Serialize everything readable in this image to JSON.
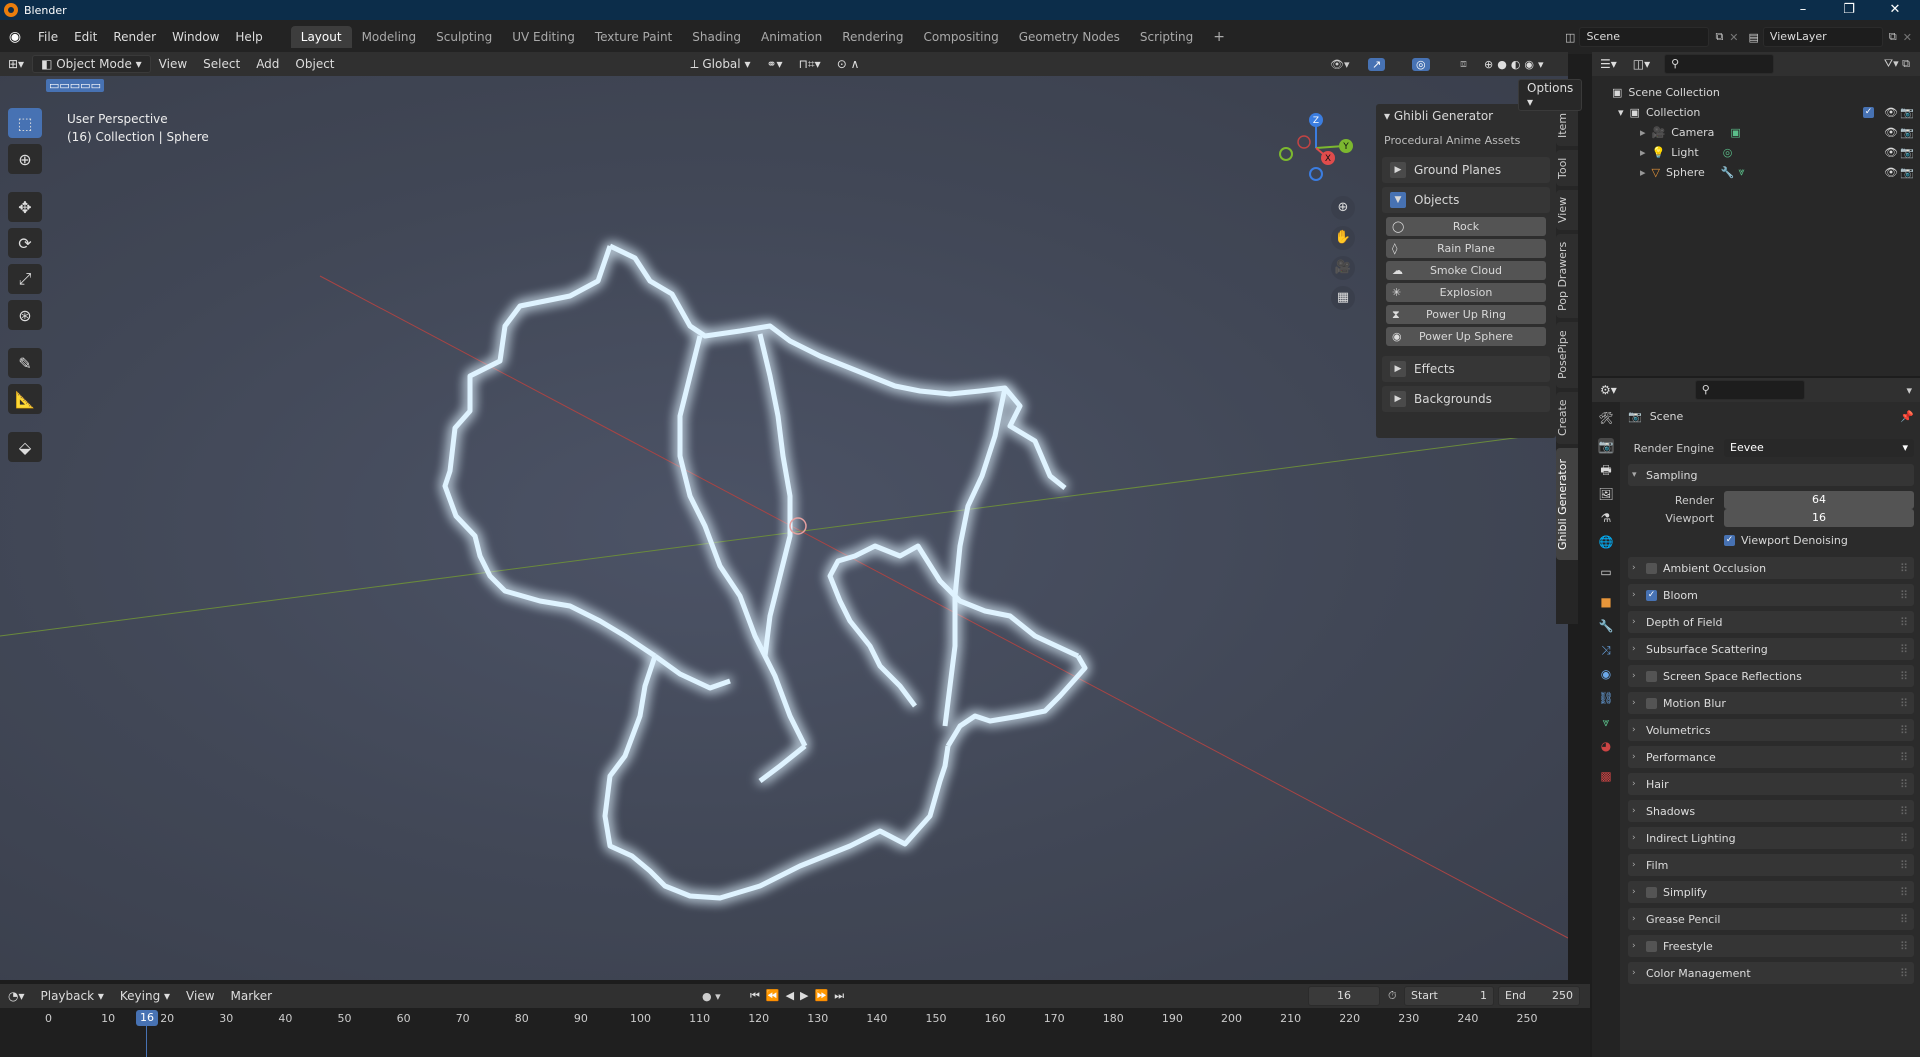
{
  "window": {
    "title": "Blender",
    "controls": [
      "–",
      "❐",
      "✕"
    ]
  },
  "menu": {
    "items": [
      "File",
      "Edit",
      "Render",
      "Window",
      "Help"
    ],
    "workspaces": [
      "Layout",
      "Modeling",
      "Sculpting",
      "UV Editing",
      "Texture Paint",
      "Shading",
      "Animation",
      "Rendering",
      "Compositing",
      "Geometry Nodes",
      "Scripting"
    ],
    "active_workspace": "Layout",
    "add": "+",
    "scene": "Scene",
    "view_layer": "ViewLayer"
  },
  "viewport_header": {
    "mode": "Object Mode",
    "menus": [
      "View",
      "Select",
      "Add",
      "Object"
    ],
    "orientation": "Global",
    "options": "Options"
  },
  "viewport": {
    "perspective": "User Perspective",
    "selection": "(16) Collection | Sphere"
  },
  "gizmo": {
    "z": "Z",
    "y": "Y",
    "x": "X"
  },
  "npanel": {
    "title": "Ghibli Generator",
    "subtitle": "Procedural Anime Assets",
    "ground": "Ground Planes",
    "objects": "Objects",
    "buttons": [
      {
        "label": "Rock",
        "icon": "◯"
      },
      {
        "label": "Rain Plane",
        "icon": "◊"
      },
      {
        "label": "Smoke Cloud",
        "icon": "☁"
      },
      {
        "label": "Explosion",
        "icon": "✳"
      },
      {
        "label": "Power Up Ring",
        "icon": "⧗"
      },
      {
        "label": "Power Up Sphere",
        "icon": "◉"
      }
    ],
    "effects": "Effects",
    "backgrounds": "Backgrounds",
    "tabs": [
      "Item",
      "Tool",
      "View",
      "Pop Drawers",
      "PosePipe",
      "Create",
      "Ghibli Generator"
    ]
  },
  "timeline": {
    "menus": [
      "Playback",
      "Keying",
      "View",
      "Marker"
    ],
    "current_frame": "16",
    "start_label": "Start",
    "start": "1",
    "end_label": "End",
    "end": "250",
    "ticks": [
      "0",
      "10",
      "20",
      "30",
      "40",
      "50",
      "60",
      "70",
      "80",
      "90",
      "100",
      "110",
      "120",
      "130",
      "140",
      "150",
      "160",
      "170",
      "180",
      "190",
      "200",
      "210",
      "220",
      "230",
      "240",
      "250"
    ]
  },
  "outliner": {
    "scene_collection": "Scene Collection",
    "collection": "Collection",
    "items": [
      "Camera",
      "Light",
      "Sphere"
    ]
  },
  "properties": {
    "scene": "Scene",
    "render_engine_label": "Render Engine",
    "render_engine": "Eevee",
    "sampling": "Sampling",
    "render_label": "Render",
    "render_value": "64",
    "viewport_label": "Viewport",
    "viewport_value": "16",
    "denoise": "Viewport Denoising",
    "sections": [
      {
        "label": "Ambient Occlusion",
        "checkbox": true,
        "checked": false
      },
      {
        "label": "Bloom",
        "checkbox": true,
        "checked": true
      },
      {
        "label": "Depth of Field",
        "checkbox": false
      },
      {
        "label": "Subsurface Scattering",
        "checkbox": false
      },
      {
        "label": "Screen Space Reflections",
        "checkbox": true,
        "checked": false
      },
      {
        "label": "Motion Blur",
        "checkbox": true,
        "checked": false
      },
      {
        "label": "Volumetrics",
        "checkbox": false
      },
      {
        "label": "Performance",
        "checkbox": false
      },
      {
        "label": "Hair",
        "checkbox": false
      },
      {
        "label": "Shadows",
        "checkbox": false
      },
      {
        "label": "Indirect Lighting",
        "checkbox": false
      },
      {
        "label": "Film",
        "checkbox": false
      },
      {
        "label": "Simplify",
        "checkbox": true,
        "checked": false
      },
      {
        "label": "Grease Pencil",
        "checkbox": false
      },
      {
        "label": "Freestyle",
        "checkbox": true,
        "checked": false
      },
      {
        "label": "Color Management",
        "checkbox": false
      }
    ]
  }
}
